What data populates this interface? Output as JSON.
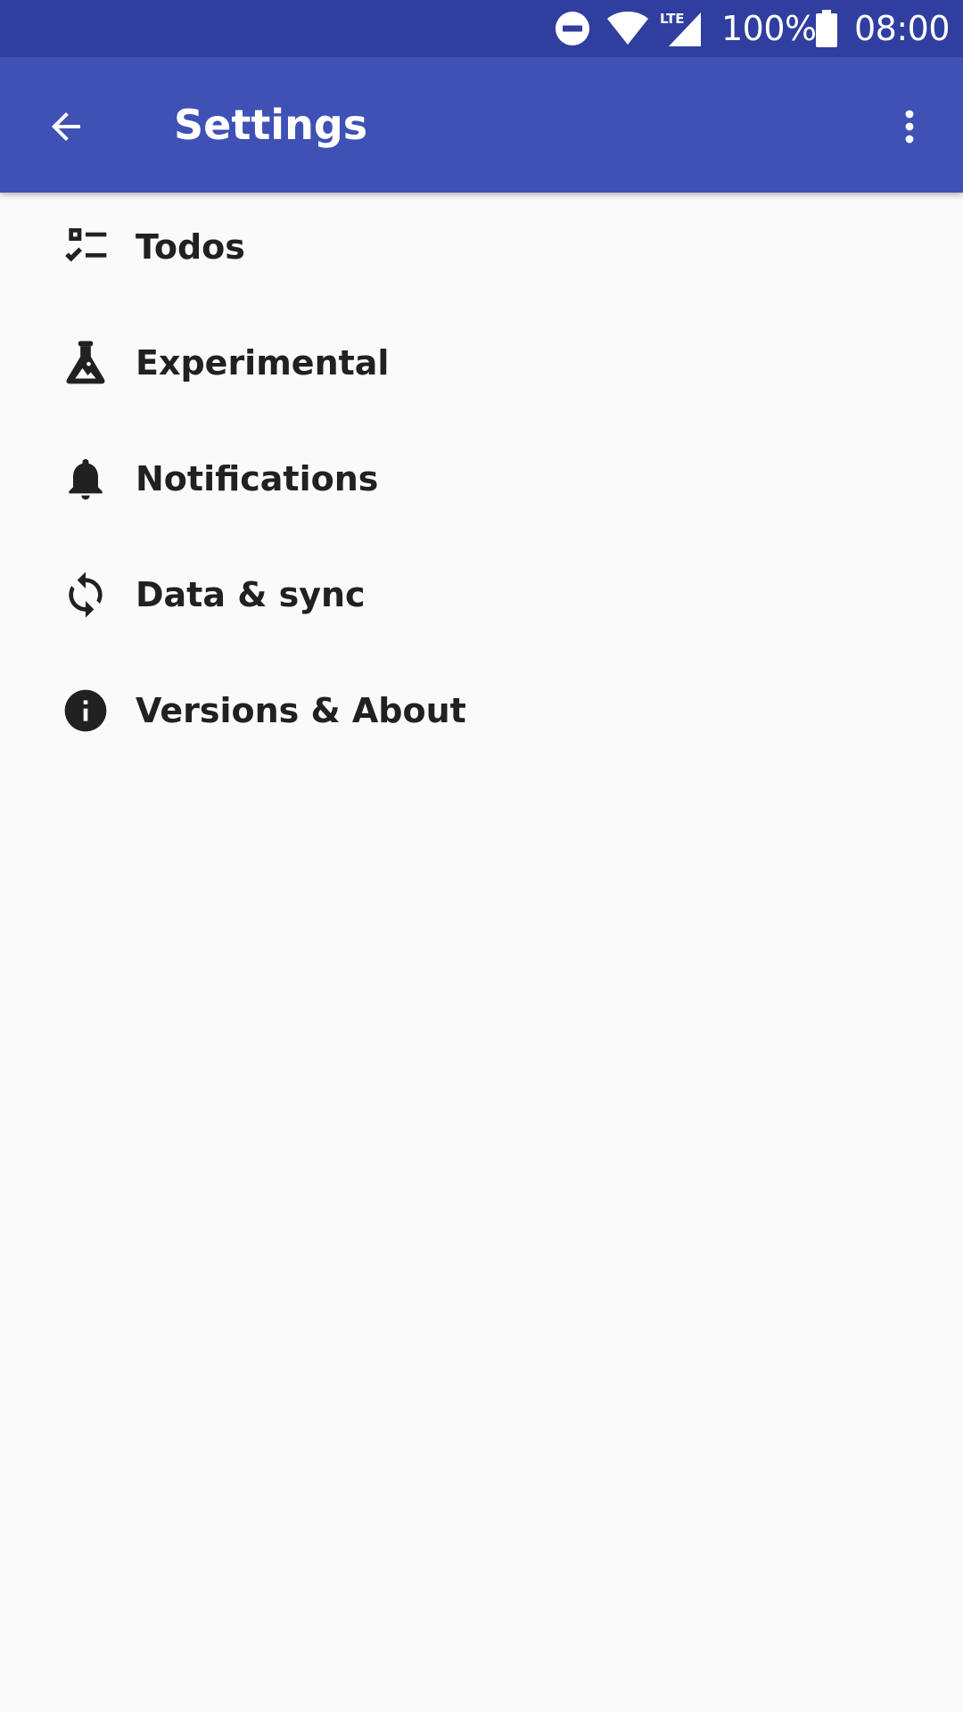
{
  "status_bar": {
    "battery": "100%",
    "time": "08:00",
    "network": "LTE",
    "icons": [
      "do-not-disturb-icon",
      "wifi-icon",
      "cellular-signal-icon",
      "battery-icon"
    ]
  },
  "app_bar": {
    "title": "Settings",
    "back_icon": "arrow-back-icon",
    "overflow_icon": "more-vert-icon"
  },
  "settings": {
    "items": [
      {
        "label": "Todos",
        "icon": "checklist-icon"
      },
      {
        "label": "Experimental",
        "icon": "flask-icon"
      },
      {
        "label": "Notifications",
        "icon": "bell-icon"
      },
      {
        "label": "Data & sync",
        "icon": "sync-icon"
      },
      {
        "label": "Versions & About",
        "icon": "info-icon"
      }
    ]
  },
  "colors": {
    "status_bar": "#303f9f",
    "app_bar": "#3f51b5",
    "background": "#fafafa",
    "text": "#212121"
  }
}
